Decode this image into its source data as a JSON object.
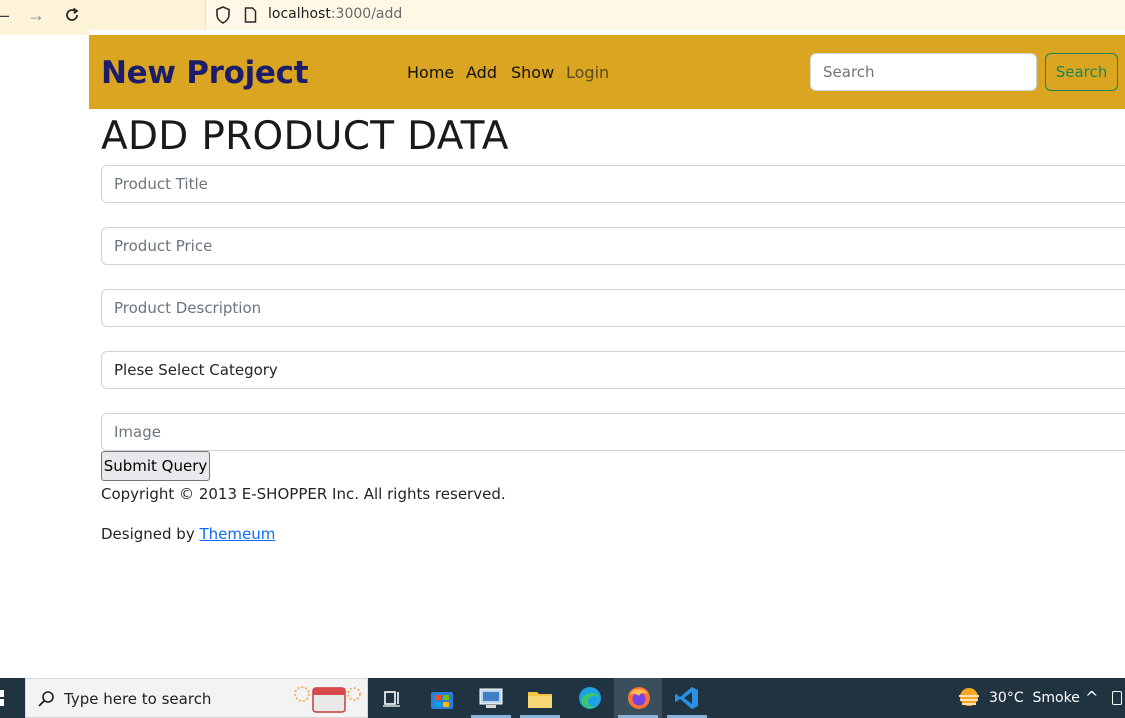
{
  "browser": {
    "url_host": "localhost",
    "url_path": ":3000/add"
  },
  "navbar": {
    "brand": "New Project",
    "links": [
      {
        "label": "Home"
      },
      {
        "label": "Add"
      },
      {
        "label": "Show"
      },
      {
        "label": "Login"
      }
    ],
    "search_placeholder": "Search",
    "search_button": "Search"
  },
  "form": {
    "title": "ADD PRODUCT DATA",
    "product_title_placeholder": "Product Title",
    "product_price_placeholder": "Product Price",
    "product_description_placeholder": "Product Description",
    "category_selected": "Plese Select Category",
    "image_placeholder": "Image",
    "submit_label": "Submit Query"
  },
  "footer": {
    "copyright": "Copyright © 2013 E-SHOPPER Inc. All rights reserved.",
    "designed_prefix": "Designed by ",
    "designed_link": "Themeum"
  },
  "taskbar": {
    "search_placeholder": "Type here to search",
    "temperature": "30°C",
    "weather": "Smoke"
  },
  "colors": {
    "navbar_bg": "#daa520",
    "brand_color": "#1c1c6b",
    "search_button_color": "#198754",
    "link_color": "#0d6efd",
    "taskbar_bg": "#1f3340"
  }
}
